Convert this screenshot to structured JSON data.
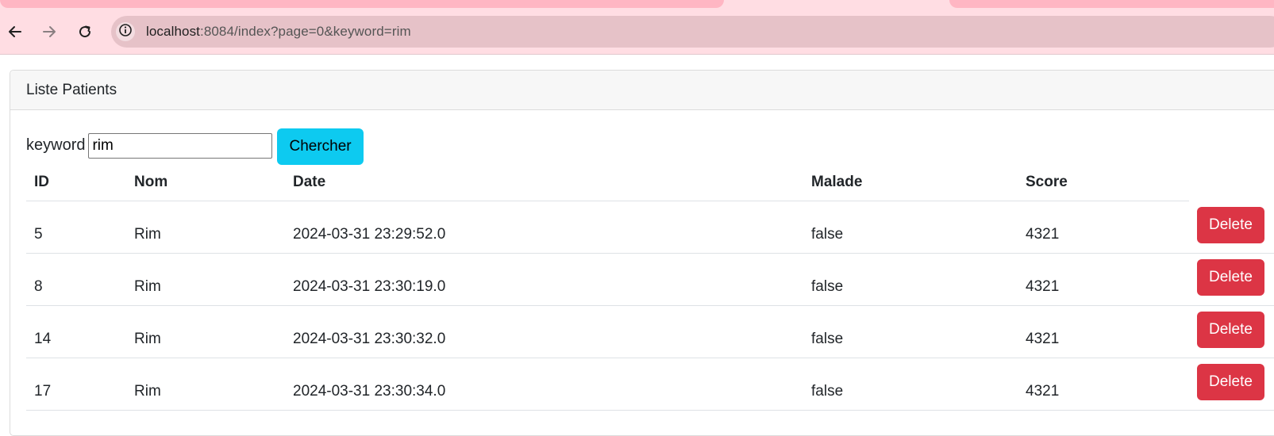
{
  "browser": {
    "url_host": "localhost",
    "url_rest": ":8084/index?page=0&keyword=rim",
    "colors": {
      "chrome": "#ffdde3",
      "omnibox": "#e6c2c8"
    }
  },
  "card": {
    "header": "Liste Patients"
  },
  "search": {
    "label": "keyword",
    "value": "rim",
    "button": "Chercher"
  },
  "table": {
    "headers": [
      "ID",
      "Nom",
      "Date",
      "Malade",
      "Score"
    ],
    "rows": [
      {
        "id": "5",
        "nom": "Rim",
        "date": "2024-03-31 23:29:52.0",
        "malade": "false",
        "score": "4321",
        "action": "Delete"
      },
      {
        "id": "8",
        "nom": "Rim",
        "date": "2024-03-31 23:30:19.0",
        "malade": "false",
        "score": "4321",
        "action": "Delete"
      },
      {
        "id": "14",
        "nom": "Rim",
        "date": "2024-03-31 23:30:32.0",
        "malade": "false",
        "score": "4321",
        "action": "Delete"
      },
      {
        "id": "17",
        "nom": "Rim",
        "date": "2024-03-31 23:30:34.0",
        "malade": "false",
        "score": "4321",
        "action": "Delete"
      }
    ]
  },
  "colors": {
    "search_button": "#0dcaf0",
    "delete_button": "#dc3545"
  },
  "icons": {
    "back": "arrow-left-icon",
    "forward": "arrow-right-icon",
    "reload": "reload-icon",
    "site_info": "info-icon"
  }
}
